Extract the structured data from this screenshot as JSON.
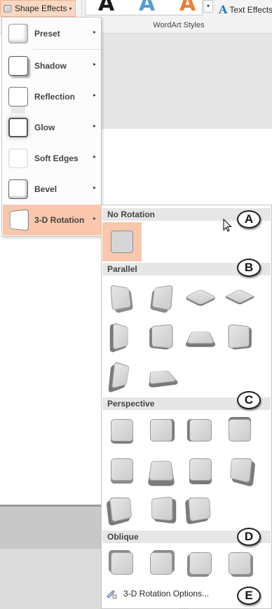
{
  "ribbon": {
    "shape_effects_label": "Shape Effects",
    "shape_effects_caret": "▾",
    "wordart_letters": [
      "A",
      "A",
      "A"
    ],
    "wordart_letter_colors": [
      "#1a1a1a",
      "#5b9bd5",
      "#ed7d31"
    ],
    "gallery_more": "▾",
    "text_effects_icon": "A",
    "text_effects_label": "Text Effects",
    "group_label": "WordArt Styles"
  },
  "menu": {
    "items": [
      {
        "label": "Preset",
        "icon": "preset-thumbnail"
      },
      {
        "label": "Shadow",
        "icon": "shadow-thumbnail"
      },
      {
        "label": "Reflection",
        "icon": "reflection-thumbnail"
      },
      {
        "label": "Glow",
        "icon": "glow-thumbnail"
      },
      {
        "label": "Soft Edges",
        "icon": "soft-edges-thumbnail"
      },
      {
        "label": "Bevel",
        "icon": "bevel-thumbnail"
      },
      {
        "label": "3-D Rotation",
        "icon": "3d-rotation-thumbnail",
        "active": true
      }
    ],
    "submenu_arrow": "▸"
  },
  "rotation_gallery": {
    "sections": [
      {
        "title": "No Rotation",
        "count": 1
      },
      {
        "title": "Parallel",
        "count": 10
      },
      {
        "title": "Perspective",
        "count": 11
      },
      {
        "title": "Oblique",
        "count": 4
      }
    ],
    "options_label": "3-D Rotation Options...",
    "grip": "....",
    "highlight_color": "#f9c7ad"
  },
  "callouts": [
    "A",
    "B",
    "C",
    "D",
    "E"
  ]
}
